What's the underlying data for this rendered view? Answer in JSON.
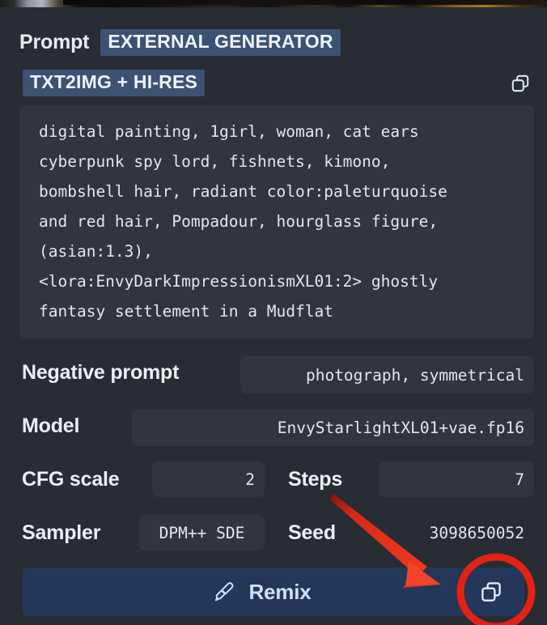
{
  "header": {
    "prompt_label": "Prompt",
    "generator_tag": "EXTERNAL GENERATOR",
    "mode_tag": "TXT2IMG + HI-RES",
    "copy_icon": "copy-icon"
  },
  "prompt": {
    "text": "digital painting, 1girl, woman, cat ears\ncyberpunk spy lord, fishnets, kimono,\nbombshell hair, radiant color:paleturquoise\nand red hair, Pompadour, hourglass figure,\n(asian:1.3),\n<lora:EnvyDarkImpressionismXL01:2> ghostly\nfantasy settlement in a Mudflat"
  },
  "params": {
    "negative_prompt": {
      "label": "Negative prompt",
      "value": "photograph, symmetrical"
    },
    "model": {
      "label": "Model",
      "value": "EnvyStarlightXL01+vae.fp16"
    },
    "cfg_scale": {
      "label": "CFG scale",
      "value": "2"
    },
    "steps": {
      "label": "Steps",
      "value": "7"
    },
    "sampler": {
      "label": "Sampler",
      "value": "DPM++ SDE"
    },
    "seed": {
      "label": "Seed",
      "value": "3098650052"
    }
  },
  "footer": {
    "remix_label": "Remix",
    "brush_icon": "paintbrush-icon",
    "copy_icon": "copy-icon"
  },
  "annotation": {
    "circle_color": "#e32213",
    "arrow_color": "#e3311c",
    "highlight_target": "copy-parameters-button"
  },
  "colors": {
    "panel_bg": "#282c33",
    "field_bg": "#31353c",
    "tag_bg": "#3b5273",
    "remix_bg": "#24365a",
    "text_primary": "#e9ecef",
    "remix_text": "#cfe0f5"
  }
}
